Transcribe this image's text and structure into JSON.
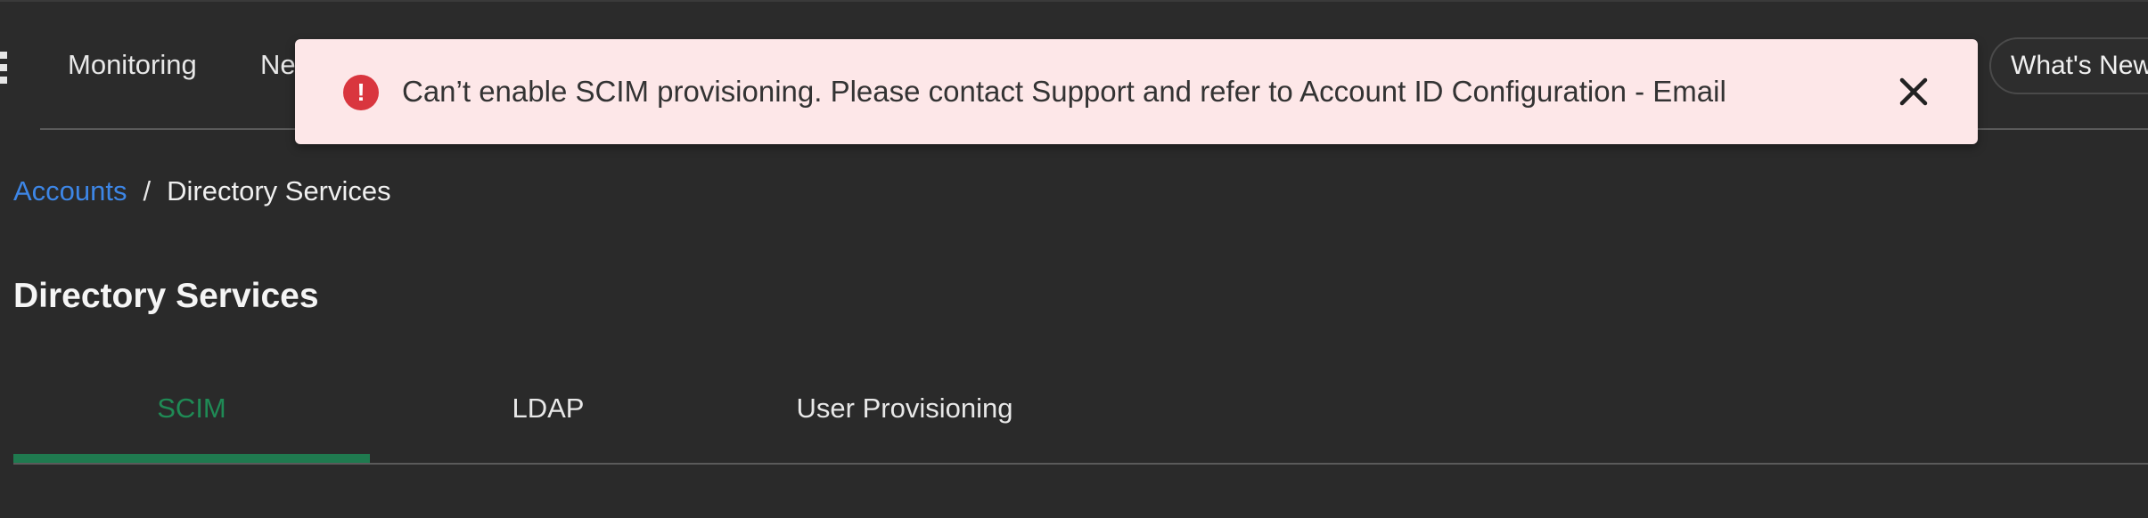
{
  "topnav": {
    "items": [
      {
        "label": "Monitoring"
      },
      {
        "label": "Ne"
      }
    ],
    "whats_new_label": "What's New"
  },
  "alert": {
    "message": "Can’t enable SCIM provisioning. Please contact Support and refer to Account ID Configuration - Email",
    "icon": "error-icon",
    "color": "#d9363e",
    "background": "#fde7e8"
  },
  "breadcrumb": {
    "link_label": "Accounts",
    "separator": "/",
    "current": "Directory Services"
  },
  "page": {
    "title": "Directory Services"
  },
  "tabs": [
    {
      "label": "SCIM",
      "active": true
    },
    {
      "label": "LDAP",
      "active": false
    },
    {
      "label": "User Provisioning",
      "active": false
    }
  ],
  "colors": {
    "accent": "#1f7a4f",
    "link": "#3d86e6",
    "background": "#2a2a2a"
  }
}
